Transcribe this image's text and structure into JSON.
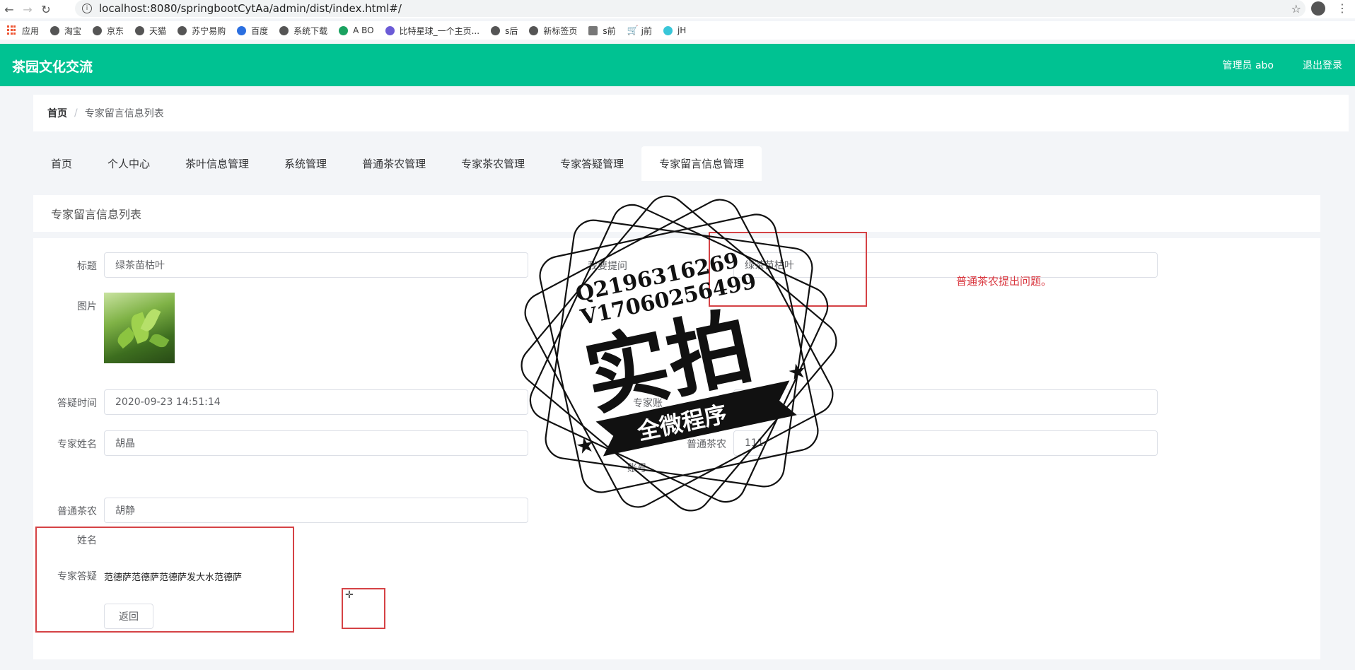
{
  "browser": {
    "url": "localhost:8080/springbootCytAa/admin/dist/index.html#/",
    "bookmarks": [
      "应用",
      "淘宝",
      "京东",
      "天猫",
      "苏宁易购",
      "百度",
      "系统下载",
      "A BO",
      "比特星球_一个主页...",
      "s后",
      "新标签页",
      "s前",
      "j前",
      "jH"
    ]
  },
  "header": {
    "title": "茶园文化交流",
    "admin": "管理员 abo",
    "logout": "退出登录"
  },
  "breadcrumb": {
    "home": "首页",
    "separator": "/",
    "current": "专家留言信息列表"
  },
  "tabs": [
    "首页",
    "个人中心",
    "茶叶信息管理",
    "系统管理",
    "普通茶农管理",
    "专家茶农管理",
    "专家答疑管理",
    "专家留言信息管理"
  ],
  "section_title": "专家留言信息列表",
  "form": {
    "title_label": "标题",
    "title_value": "绿茶苗枯叶",
    "question_label": "我要提问",
    "question_value": "绿茶苗枯叶",
    "image_label": "图片",
    "time_label": "答疑时间",
    "time_value": "2020-09-23 14:51:14",
    "expert_account_label": "专家账",
    "expert_name_label": "专家姓名",
    "expert_name_value": "胡晶",
    "farmer_account_label_1": "普通茶农",
    "farmer_account_label_2": "账号",
    "farmer_account_value": "111",
    "farmer_name_label_1": "普通茶农",
    "farmer_name_label_2": "姓名",
    "farmer_name_value": "胡静",
    "answer_label": "专家答疑",
    "answer_value": "范德萨范德萨范德萨发大水范德萨",
    "back_button": "返回",
    "note": "普通茶农提出问题。"
  },
  "watermark": {
    "line1": "Q2196316269",
    "line2": "V17060256499",
    "big": "实拍",
    "banner": "全微程序"
  },
  "colors": {
    "header_green": "#00c292",
    "annotation_red": "#d54245"
  }
}
